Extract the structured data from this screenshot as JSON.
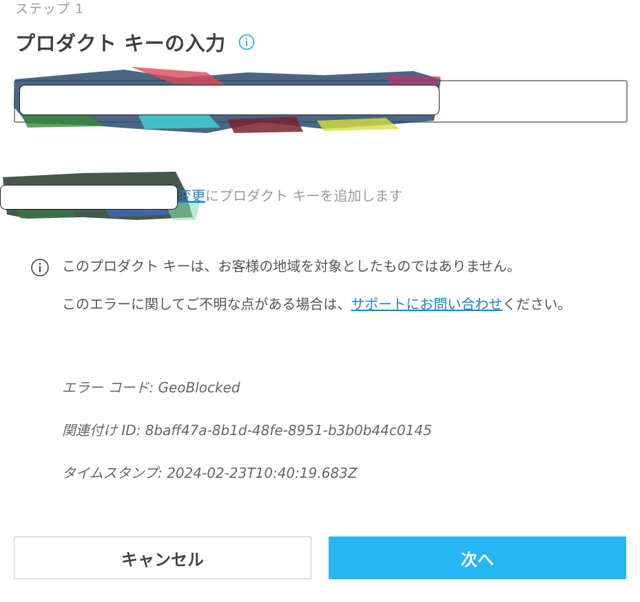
{
  "step": {
    "label": "ステップ 1"
  },
  "header": {
    "title": "プロダクト キーの入力",
    "info_icon": "info-icon",
    "info_icon_color": "#1aa7e6"
  },
  "key_input": {
    "value": "",
    "redacted": true
  },
  "account": {
    "redacted": true,
    "change_link": "変更",
    "suffix": "にプロダクト キーを追加します"
  },
  "error": {
    "icon": "info-icon",
    "message": "このプロダクト キーは、お客様の地域を対象としたものではありません。",
    "help_prefix": "このエラーに関してご不明な点がある場合は、",
    "help_link": "サポートにお問い合わせ",
    "help_suffix": "ください。",
    "code": "エラー コード: GeoBlocked",
    "correlation_id": "関連付け ID: 8baff47a-8b1d-48fe-8951-b3b0b44c0145",
    "timestamp": "タイムスタンプ: 2024-02-23T10:40:19.683Z"
  },
  "buttons": {
    "cancel": "キャンセル",
    "next": "次へ"
  },
  "colors": {
    "accent": "#27b6f5",
    "link": "#1a82c9"
  }
}
